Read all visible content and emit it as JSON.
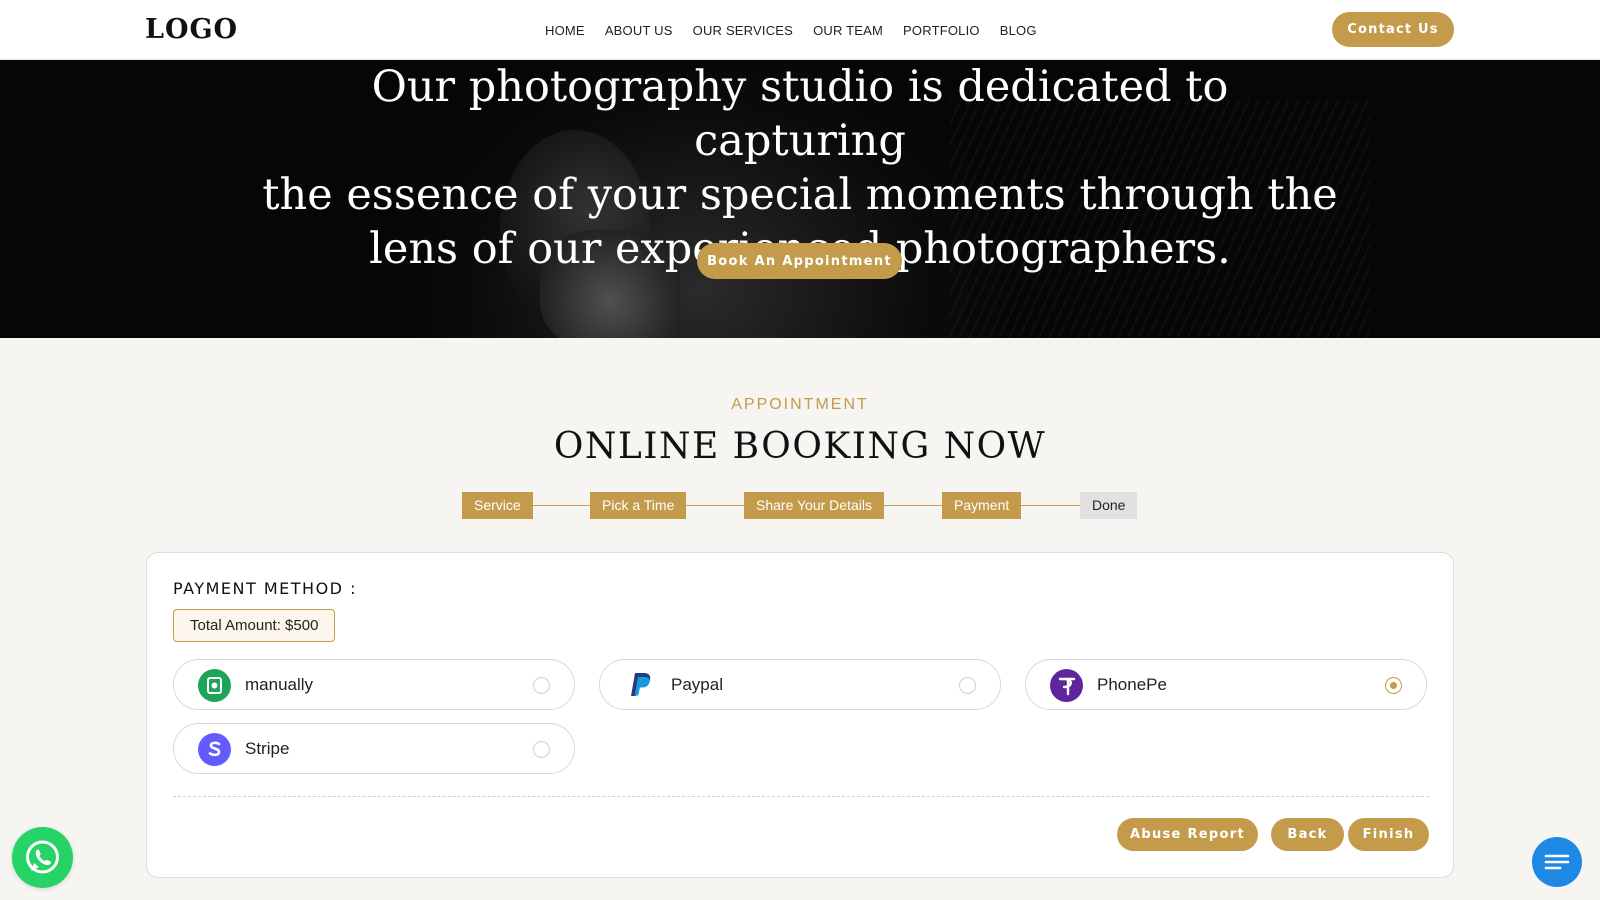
{
  "header": {
    "logo": "LOGO",
    "nav": [
      "HOME",
      "ABOUT US",
      "OUR SERVICES",
      "OUR TEAM",
      "PORTFOLIO",
      "BLOG"
    ],
    "contact_label": "Contact Us"
  },
  "hero": {
    "lines": [
      "Our photography studio is dedicated to capturing",
      "the essence of your special moments through the",
      "lens of our experienced photographers."
    ],
    "book_label": "Book An Appointment"
  },
  "section": {
    "eyebrow": "APPOINTMENT",
    "title": "ONLINE BOOKING NOW"
  },
  "steps": [
    {
      "label": "Service",
      "status": "completed"
    },
    {
      "label": "Pick a Time",
      "status": "completed"
    },
    {
      "label": "Share Your Details",
      "status": "completed"
    },
    {
      "label": "Payment",
      "status": "current"
    },
    {
      "label": "Done",
      "status": "pending"
    }
  ],
  "payment": {
    "heading": "PAYMENT METHOD :",
    "total": "Total Amount: $500",
    "options": [
      {
        "label": "manually",
        "icon": "cash-icon",
        "selected": false
      },
      {
        "label": "Paypal",
        "icon": "paypal-icon",
        "selected": false
      },
      {
        "label": "PhonePe",
        "icon": "phonepe-icon",
        "selected": true
      },
      {
        "label": "Stripe",
        "icon": "stripe-icon",
        "selected": false
      }
    ],
    "buttons": {
      "abuse": "Abuse Report",
      "back": "Back",
      "finish": "Finish"
    }
  },
  "colors": {
    "accent": "#c49a4b",
    "whatsapp": "#25d366",
    "chat": "#1e88e5",
    "phonepe": "#5f259f",
    "stripe": "#635bff",
    "paypal_dark": "#253b80",
    "paypal_light": "#179bd7",
    "cash": "#1da35a"
  }
}
